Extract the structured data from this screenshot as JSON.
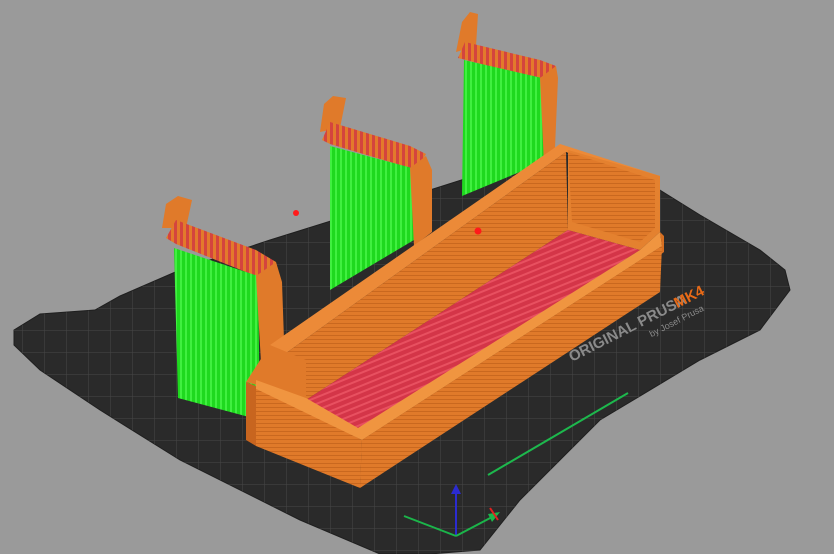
{
  "viewport": {
    "background": "#9a9a9a"
  },
  "bed": {
    "logo_brand": "ORIGINAL PRUSA",
    "logo_model": "MK4",
    "logo_byline": "by Josef Prusa",
    "plate_color": "#2b2b2b",
    "grid_color": "#4a4a4a",
    "logo_model_color": "#e86a17"
  },
  "model": {
    "wall_color": "#e07a2a",
    "wall_dark": "#c8651f",
    "wall_light": "#f0943e",
    "infill_color": "#d8364a",
    "support_color": "#22e022"
  },
  "axes": {
    "x_color": "#1bb54a",
    "y_color": "#2b2bd0",
    "z_color": "#2b2bd0"
  },
  "markers": {
    "seam_color": "#ff1a1a"
  }
}
